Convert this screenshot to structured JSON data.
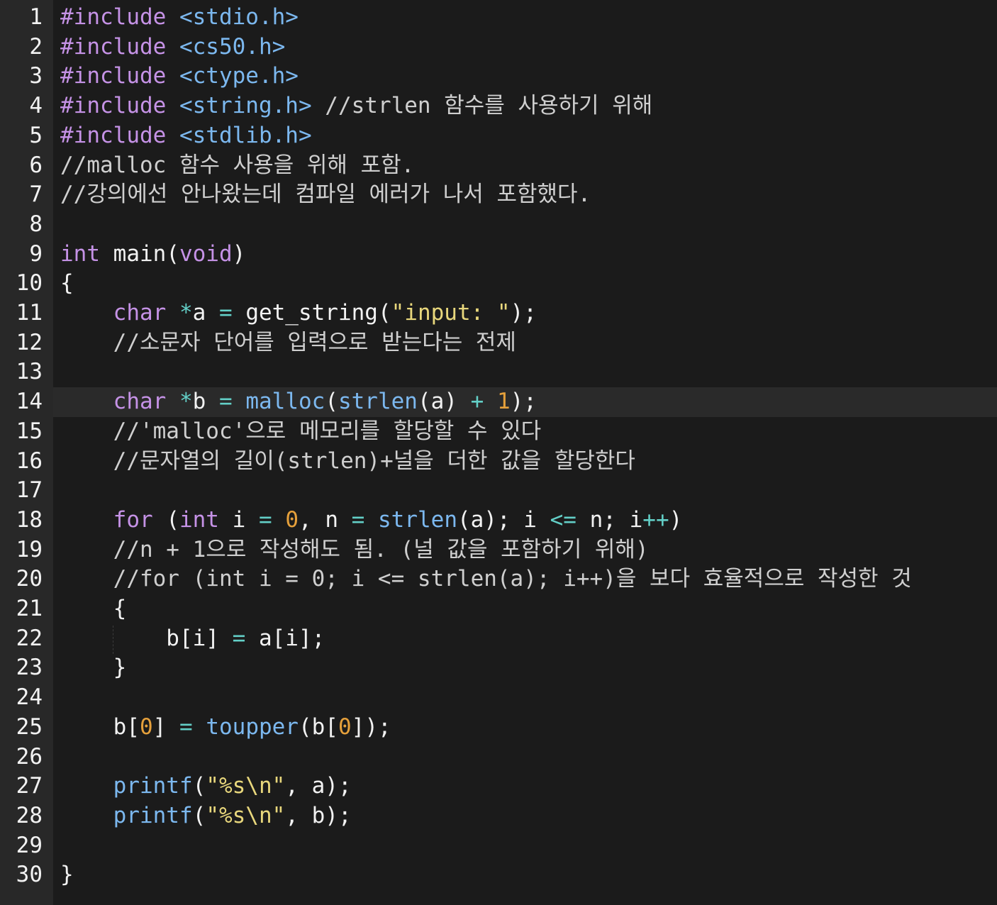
{
  "editor": {
    "colors": {
      "background": "#1b1b1b",
      "gutter": "#282828",
      "active_line": "#2a2a2a",
      "keyword": "#c592e6",
      "function": "#7cb8ef",
      "string": "#e8d77c",
      "number": "#e5a03b",
      "operator": "#63cfc7",
      "text": "#f2f2f2"
    },
    "active_line_number": "14",
    "lines": [
      {
        "n": "1",
        "tokens": [
          {
            "t": "#include",
            "c": "kw-pp"
          },
          {
            "t": " ",
            "c": "plain"
          },
          {
            "t": "<stdio.h>",
            "c": "hdr"
          }
        ]
      },
      {
        "n": "2",
        "tokens": [
          {
            "t": "#include",
            "c": "kw-pp"
          },
          {
            "t": " ",
            "c": "plain"
          },
          {
            "t": "<cs50.h>",
            "c": "hdr"
          }
        ]
      },
      {
        "n": "3",
        "tokens": [
          {
            "t": "#include",
            "c": "kw-pp"
          },
          {
            "t": " ",
            "c": "plain"
          },
          {
            "t": "<ctype.h>",
            "c": "hdr"
          }
        ]
      },
      {
        "n": "4",
        "tokens": [
          {
            "t": "#include",
            "c": "kw-pp"
          },
          {
            "t": " ",
            "c": "plain"
          },
          {
            "t": "<string.h>",
            "c": "hdr"
          },
          {
            "t": " //strlen 함수를 사용하기 위해",
            "c": "cm"
          }
        ]
      },
      {
        "n": "5",
        "tokens": [
          {
            "t": "#include",
            "c": "kw-pp"
          },
          {
            "t": " ",
            "c": "plain"
          },
          {
            "t": "<stdlib.h>",
            "c": "hdr"
          }
        ]
      },
      {
        "n": "6",
        "tokens": [
          {
            "t": "//malloc 함수 사용을 위해 포함.",
            "c": "cm"
          }
        ]
      },
      {
        "n": "7",
        "tokens": [
          {
            "t": "//강의에선 안나왔는데 컴파일 에러가 나서 포함했다.",
            "c": "cm"
          }
        ]
      },
      {
        "n": "8",
        "tokens": []
      },
      {
        "n": "9",
        "tokens": [
          {
            "t": "int",
            "c": "kw-ty"
          },
          {
            "t": " main(",
            "c": "plain"
          },
          {
            "t": "void",
            "c": "kw-ty"
          },
          {
            "t": ")",
            "c": "plain"
          }
        ]
      },
      {
        "n": "10",
        "tokens": [
          {
            "t": "{",
            "c": "plain"
          }
        ]
      },
      {
        "n": "11",
        "tokens": [
          {
            "t": "    ",
            "c": "plain"
          },
          {
            "t": "char",
            "c": "kw-ty"
          },
          {
            "t": " ",
            "c": "plain"
          },
          {
            "t": "*",
            "c": "op"
          },
          {
            "t": "a ",
            "c": "plain"
          },
          {
            "t": "=",
            "c": "op"
          },
          {
            "t": " get_string(",
            "c": "plain"
          },
          {
            "t": "\"input: \"",
            "c": "str"
          },
          {
            "t": ");",
            "c": "plain"
          }
        ]
      },
      {
        "n": "12",
        "tokens": [
          {
            "t": "    //소문자 단어를 입력으로 받는다는 전제",
            "c": "cm"
          }
        ]
      },
      {
        "n": "13",
        "tokens": []
      },
      {
        "n": "14",
        "tokens": [
          {
            "t": "    ",
            "c": "plain"
          },
          {
            "t": "char",
            "c": "kw-ty"
          },
          {
            "t": " ",
            "c": "plain"
          },
          {
            "t": "*",
            "c": "op"
          },
          {
            "t": "b ",
            "c": "plain"
          },
          {
            "t": "=",
            "c": "op"
          },
          {
            "t": " ",
            "c": "plain"
          },
          {
            "t": "malloc",
            "c": "fn"
          },
          {
            "t": "(",
            "c": "plain"
          },
          {
            "t": "strlen",
            "c": "fn"
          },
          {
            "t": "(a) ",
            "c": "plain"
          },
          {
            "t": "+",
            "c": "op"
          },
          {
            "t": " ",
            "c": "plain"
          },
          {
            "t": "1",
            "c": "num"
          },
          {
            "t": ");",
            "c": "plain"
          }
        ]
      },
      {
        "n": "15",
        "tokens": [
          {
            "t": "    //'malloc'으로 메모리를 할당할 수 있다",
            "c": "cm"
          }
        ]
      },
      {
        "n": "16",
        "tokens": [
          {
            "t": "    //문자열의 길이(strlen)+널을 더한 값을 할당한다",
            "c": "cm"
          }
        ]
      },
      {
        "n": "17",
        "tokens": []
      },
      {
        "n": "18",
        "tokens": [
          {
            "t": "    ",
            "c": "plain"
          },
          {
            "t": "for",
            "c": "kw-ty"
          },
          {
            "t": " (",
            "c": "plain"
          },
          {
            "t": "int",
            "c": "kw-ty"
          },
          {
            "t": " i ",
            "c": "plain"
          },
          {
            "t": "=",
            "c": "op"
          },
          {
            "t": " ",
            "c": "plain"
          },
          {
            "t": "0",
            "c": "num"
          },
          {
            "t": ", n ",
            "c": "plain"
          },
          {
            "t": "=",
            "c": "op"
          },
          {
            "t": " ",
            "c": "plain"
          },
          {
            "t": "strlen",
            "c": "fn"
          },
          {
            "t": "(a); i ",
            "c": "plain"
          },
          {
            "t": "<=",
            "c": "op"
          },
          {
            "t": " n; i",
            "c": "plain"
          },
          {
            "t": "++",
            "c": "op"
          },
          {
            "t": ")",
            "c": "plain"
          }
        ]
      },
      {
        "n": "19",
        "tokens": [
          {
            "t": "    //n + 1으로 작성해도 됨. (널 값을 포함하기 위해)",
            "c": "cm"
          }
        ]
      },
      {
        "n": "20",
        "tokens": [
          {
            "t": "    //for (int i = 0; i <= strlen(a); i++)을 보다 효율적으로 작성한 것",
            "c": "cm"
          }
        ]
      },
      {
        "n": "21",
        "tokens": [
          {
            "t": "    {",
            "c": "plain"
          }
        ]
      },
      {
        "n": "22",
        "tokens": [
          {
            "t": "        b[i] ",
            "c": "plain"
          },
          {
            "t": "=",
            "c": "op"
          },
          {
            "t": " a[i];",
            "c": "plain"
          }
        ]
      },
      {
        "n": "23",
        "tokens": [
          {
            "t": "    }",
            "c": "plain"
          }
        ]
      },
      {
        "n": "24",
        "tokens": []
      },
      {
        "n": "25",
        "tokens": [
          {
            "t": "    b[",
            "c": "plain"
          },
          {
            "t": "0",
            "c": "num"
          },
          {
            "t": "] ",
            "c": "plain"
          },
          {
            "t": "=",
            "c": "op"
          },
          {
            "t": " ",
            "c": "plain"
          },
          {
            "t": "toupper",
            "c": "fn"
          },
          {
            "t": "(b[",
            "c": "plain"
          },
          {
            "t": "0",
            "c": "num"
          },
          {
            "t": "]);",
            "c": "plain"
          }
        ]
      },
      {
        "n": "26",
        "tokens": []
      },
      {
        "n": "27",
        "tokens": [
          {
            "t": "    ",
            "c": "plain"
          },
          {
            "t": "printf",
            "c": "fn"
          },
          {
            "t": "(",
            "c": "plain"
          },
          {
            "t": "\"%s\\n\"",
            "c": "str"
          },
          {
            "t": ", a);",
            "c": "plain"
          }
        ]
      },
      {
        "n": "28",
        "tokens": [
          {
            "t": "    ",
            "c": "plain"
          },
          {
            "t": "printf",
            "c": "fn"
          },
          {
            "t": "(",
            "c": "plain"
          },
          {
            "t": "\"%s\\n\"",
            "c": "str"
          },
          {
            "t": ", b);",
            "c": "plain"
          }
        ]
      },
      {
        "n": "29",
        "tokens": []
      },
      {
        "n": "30",
        "tokens": [
          {
            "t": "}",
            "c": "plain"
          }
        ]
      }
    ]
  }
}
